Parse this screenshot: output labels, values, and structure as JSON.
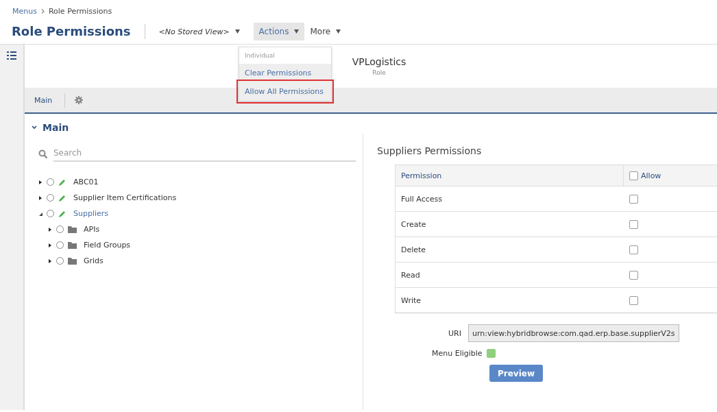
{
  "breadcrumb": [
    "Menus",
    "Role Permissions"
  ],
  "page_title": "Role Permissions",
  "stored_view": "<No Stored View>",
  "menus": [
    {
      "label": "Actions",
      "selected": true
    },
    {
      "label": "More",
      "selected": false
    }
  ],
  "actions_menu": {
    "header": "Individual",
    "items": [
      {
        "label": "Clear Permissions",
        "highlighted": false
      },
      {
        "label": "Allow All Permissions",
        "highlighted": true
      }
    ]
  },
  "record": {
    "name": "VPLogistics",
    "type": "Role"
  },
  "toolbar_tabs": [
    {
      "label": "Main",
      "selected": true
    }
  ],
  "section_title": "Main",
  "search": {
    "placeholder": "Search"
  },
  "tree": [
    {
      "label": "ABC01",
      "kind": "edit",
      "expanded": false,
      "selected": false
    },
    {
      "label": "Supplier Item Certifications",
      "kind": "edit",
      "expanded": false,
      "selected": false
    },
    {
      "label": "Suppliers",
      "kind": "edit",
      "expanded": true,
      "selected": true,
      "children": [
        {
          "label": "APIs",
          "kind": "folder",
          "expanded": false,
          "selected": false
        },
        {
          "label": "Field Groups",
          "kind": "folder",
          "expanded": false,
          "selected": false
        },
        {
          "label": "Grids",
          "kind": "folder",
          "expanded": false,
          "selected": false
        }
      ]
    }
  ],
  "permissions_title": "Suppliers Permissions",
  "table": {
    "columns": [
      "Permission",
      "Allow"
    ],
    "allow_all_checked": false,
    "rows": [
      {
        "permission": "Full Access",
        "checked": false
      },
      {
        "permission": "Create",
        "checked": false
      },
      {
        "permission": "Delete",
        "checked": false
      },
      {
        "permission": "Read",
        "checked": false
      },
      {
        "permission": "Write",
        "checked": false
      }
    ]
  },
  "uri": {
    "label": "URI",
    "value": "urn:view:hybridbrowse:com.qad.erp.base.supplierV2s"
  },
  "menu_eligible": {
    "label": "Menu Eligible",
    "checked": true
  },
  "preview_button": "Preview"
}
